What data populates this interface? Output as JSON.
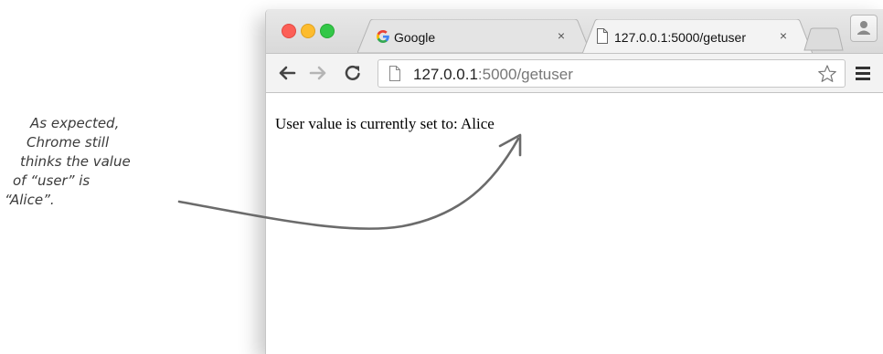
{
  "window": {
    "tabs": [
      {
        "title": "Google",
        "close_glyph": "×",
        "icon": "google-g-icon",
        "active": false
      },
      {
        "title": "127.0.0.1:5000/getuser",
        "close_glyph": "×",
        "icon": "page-icon",
        "active": true
      }
    ]
  },
  "toolbar": {
    "url_host": "127.0.0.1",
    "url_rest": ":5000/getuser"
  },
  "page": {
    "text": "User value is currently set to: Alice"
  },
  "annotation": {
    "lines": [
      "As expected,",
      "Chrome still",
      "thinks the value",
      "of “user” is",
      "“Alice”."
    ]
  },
  "colors": {
    "close_red": "#fc5f57",
    "minimize_yellow": "#fdbc2e",
    "zoom_green": "#33c748",
    "annotation_ink": "#3b3b3b"
  }
}
